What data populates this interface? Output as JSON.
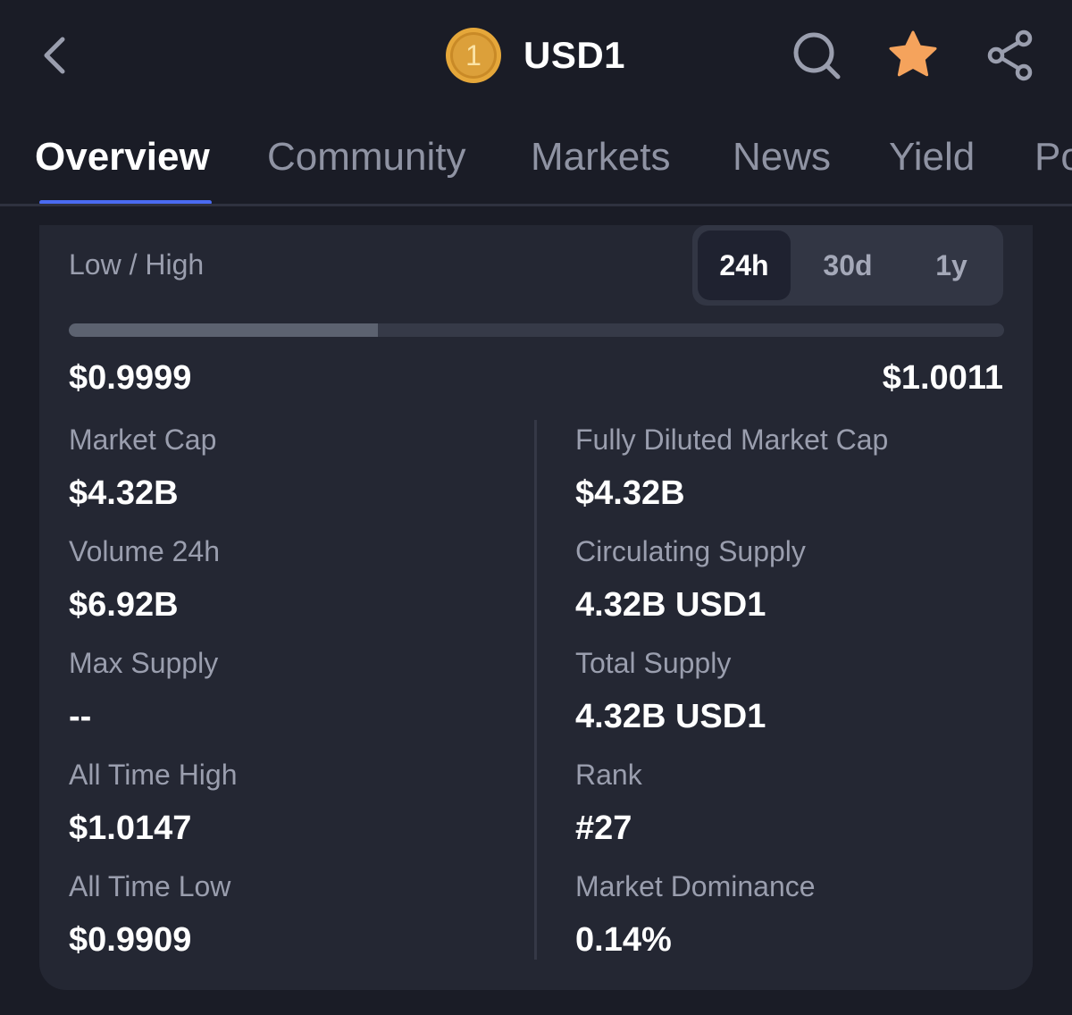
{
  "header": {
    "coin_symbol": "USD1",
    "logo_glyph": "1",
    "icons": [
      "chevron-left-icon",
      "search-icon",
      "star-icon",
      "share-icon"
    ],
    "colors": {
      "star": "#f5a35c",
      "coin": "#e5a73a"
    }
  },
  "tabs": [
    {
      "label": "Overview",
      "active": true
    },
    {
      "label": "Community",
      "active": false
    },
    {
      "label": "Markets",
      "active": false
    },
    {
      "label": "News",
      "active": false
    },
    {
      "label": "Yield",
      "active": false
    },
    {
      "label": "Po",
      "active": false
    }
  ],
  "range": {
    "label": "Low / High",
    "options": [
      "24h",
      "30d",
      "1y"
    ],
    "selected": "24h",
    "low": "$0.9999",
    "high": "$1.0011",
    "fill_fraction": 0.33
  },
  "stats": {
    "left": [
      {
        "label": "Market Cap",
        "value": "$4.32B"
      },
      {
        "label": "Volume 24h",
        "value": "$6.92B"
      },
      {
        "label": "Max Supply",
        "value": "--"
      },
      {
        "label": "All Time High",
        "value": "$1.0147"
      },
      {
        "label": "All Time Low",
        "value": "$0.9909"
      }
    ],
    "right": [
      {
        "label": "Fully Diluted Market Cap",
        "value": "$4.32B"
      },
      {
        "label": "Circulating Supply",
        "value": "4.32B USD1"
      },
      {
        "label": "Total Supply",
        "value": "4.32B USD1"
      },
      {
        "label": "Rank",
        "value": "#27"
      },
      {
        "label": "Market Dominance",
        "value": "0.14%"
      }
    ]
  },
  "accent_color": "#4a6bf2"
}
